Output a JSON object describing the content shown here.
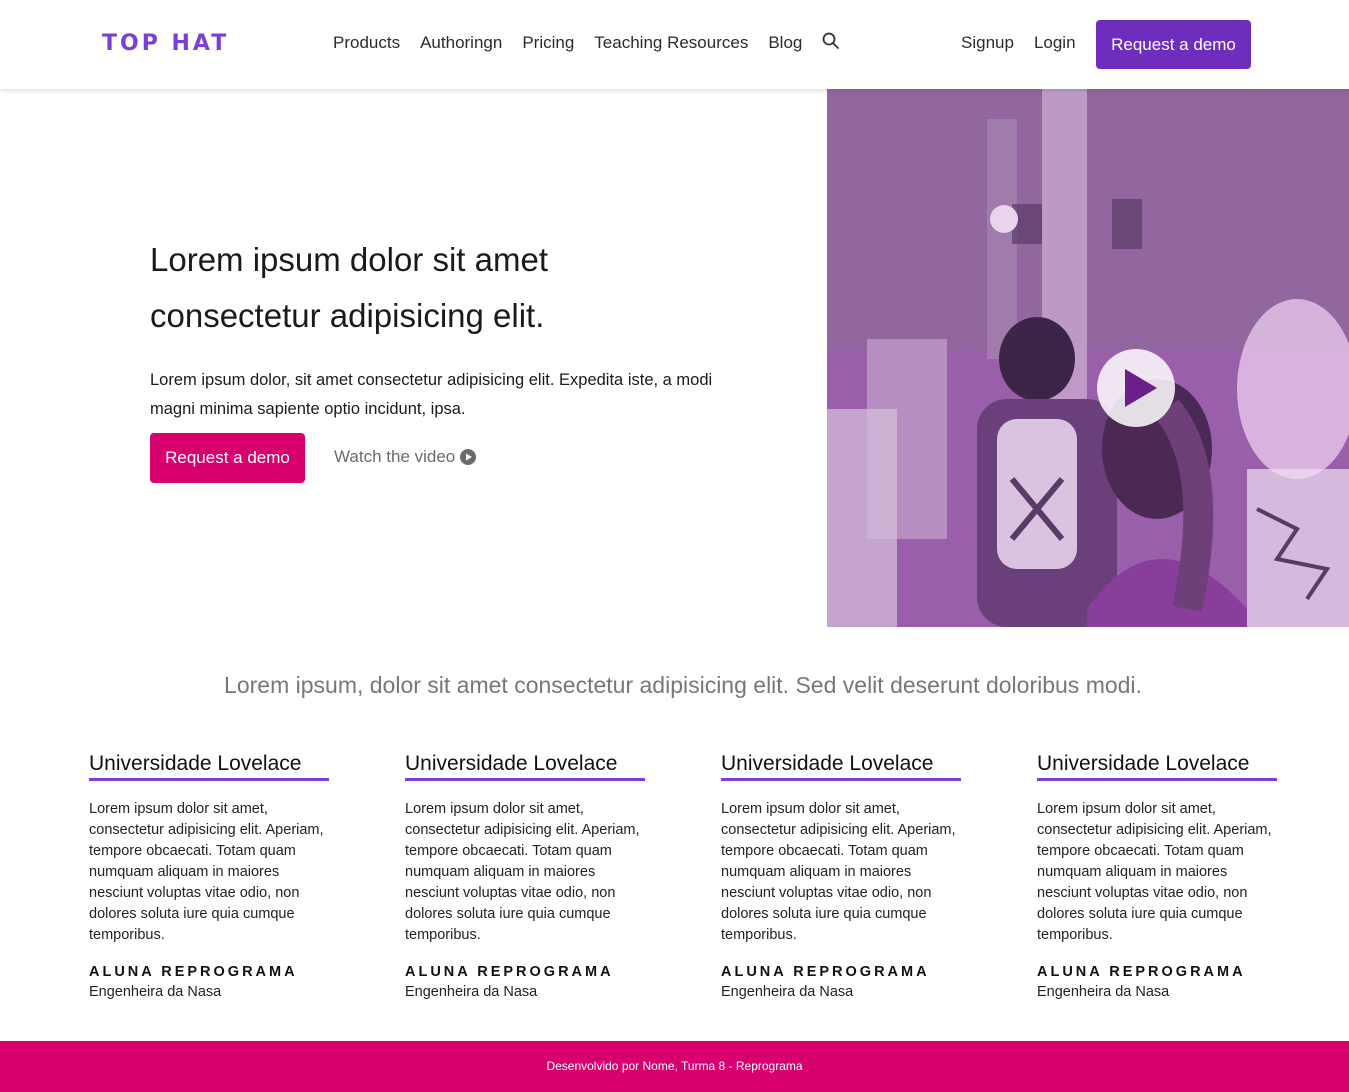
{
  "brand": {
    "logo": "TOP HAT",
    "accent": "#7b3fd6",
    "primary_button": "#6f2dbd",
    "hero_button": "#d8006f"
  },
  "nav": {
    "items": [
      "Products",
      "Authoringn",
      "Pricing",
      "Teaching Resources",
      "Blog"
    ],
    "search_icon": "search-icon"
  },
  "auth": {
    "signup": "Signup",
    "login": "Login",
    "request_demo": "Request a demo"
  },
  "hero": {
    "title_line1": "Lorem ipsum dolor sit amet",
    "title_line2": "consectetur adipisicing elit.",
    "description": "Lorem ipsum dolor, sit amet consectetur adipisicing elit. Expedita iste, a modi magni minima sapiente optio incidunt, ipsa.",
    "cta": "Request a demo",
    "watch_video": "Watch the video",
    "image_icon": "play-icon"
  },
  "subtitle": "Lorem ipsum, dolor sit amet consectetur adipisicing elit. Sed velit deserunt doloribus modi.",
  "testimonials": [
    {
      "title": "Universidade Lovelace",
      "text": "Lorem ipsum dolor sit amet, consectetur adipisicing elit. Aperiam, tempore obcaecati. Totam quam numquam aliquam in maiores nesciunt voluptas vitae odio, non dolores soluta iure quia cumque temporibus.",
      "role": "ALUNA REPROGRAMA",
      "job": "Engenheira da Nasa"
    },
    {
      "title": "Universidade Lovelace",
      "text": "Lorem ipsum dolor sit amet, consectetur adipisicing elit. Aperiam, tempore obcaecati. Totam quam numquam aliquam in maiores nesciunt voluptas vitae odio, non dolores soluta iure quia cumque temporibus.",
      "role": "ALUNA REPROGRAMA",
      "job": "Engenheira da Nasa"
    },
    {
      "title": "Universidade Lovelace",
      "text": "Lorem ipsum dolor sit amet, consectetur adipisicing elit. Aperiam, tempore obcaecati. Totam quam numquam aliquam in maiores nesciunt voluptas vitae odio, non dolores soluta iure quia cumque temporibus.",
      "role": "ALUNA REPROGRAMA",
      "job": "Engenheira da Nasa"
    },
    {
      "title": "Universidade Lovelace",
      "text": "Lorem ipsum dolor sit amet, consectetur adipisicing elit. Aperiam, tempore obcaecati. Totam quam numquam aliquam in maiores nesciunt voluptas vitae odio, non dolores soluta iure quia cumque temporibus.",
      "role": "ALUNA REPROGRAMA",
      "job": "Engenheira da Nasa"
    }
  ],
  "footer": {
    "text": "Desenvolvido por Nome, Turma 8 - Reprograma"
  }
}
